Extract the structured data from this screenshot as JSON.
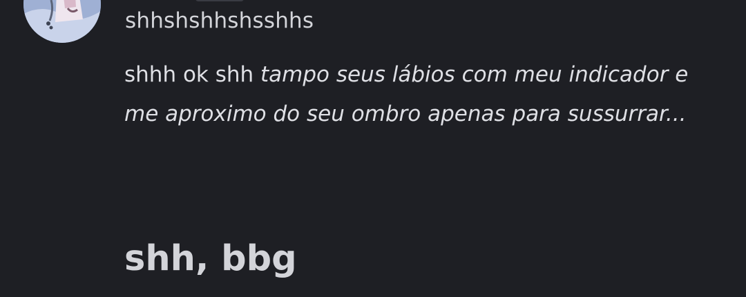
{
  "message": {
    "author": "shhshshhshsshhs",
    "text_plain": "shhh ok  shh ",
    "text_action": "tampo seus lábios com meu indicador e me aproximo do seu ombro apenas para sussurrar...",
    "heading": "shh, bbg"
  },
  "colors": {
    "background": "#1e1f24",
    "username": "#d4d5da",
    "text": "#dfe0e5"
  },
  "icons": {
    "avatar": "user-avatar"
  }
}
